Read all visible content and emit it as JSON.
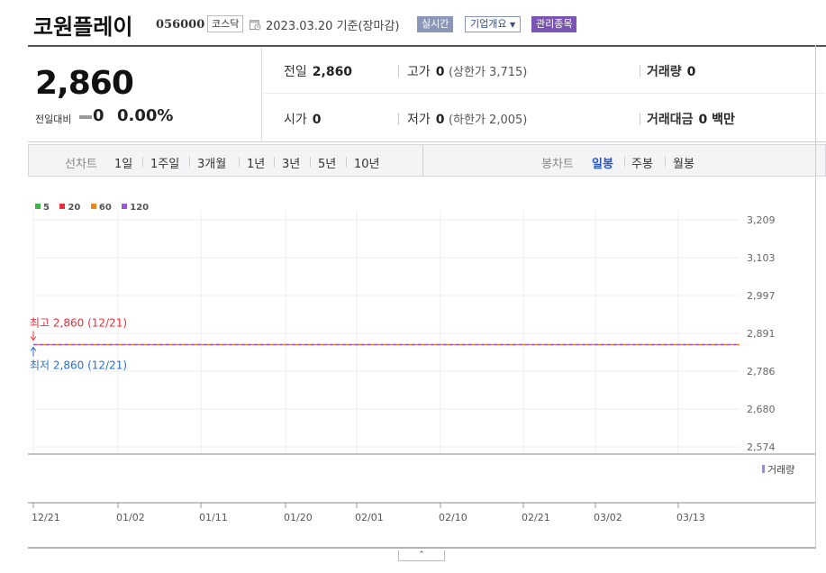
{
  "header": {
    "company_name": "코원플레이",
    "code": "056000",
    "market": "코스닥",
    "base_date": "2023.03.20 기준(장마감)",
    "btn_realtime": "실시간",
    "btn_overview": "기업개요",
    "btn_managed": "관리종목"
  },
  "price": {
    "current": "2,860",
    "change_label": "전일대비",
    "change_value": "0",
    "change_rate": "0.00%"
  },
  "info": {
    "prev_label": "전일",
    "prev_value": "2,860",
    "high_label": "고가",
    "high_value": "0",
    "upper_limit": "(상한가 3,715)",
    "volume_label": "거래량",
    "volume_value": "0",
    "open_label": "시가",
    "open_value": "0",
    "low_label": "저가",
    "low_value": "0",
    "lower_limit": "(하한가 2,005)",
    "amount_label": "거래대금",
    "amount_value": "0 백만"
  },
  "tabs": {
    "line_label": "선차트",
    "line_items": [
      "1일",
      "1주일",
      "3개월",
      "1년",
      "3년",
      "5년",
      "10년"
    ],
    "candle_label": "봉차트",
    "candle_items": [
      "일봉",
      "주봉",
      "월봉"
    ],
    "active_candle": "일봉"
  },
  "legend": [
    {
      "name": "5",
      "color": "#3cb44b"
    },
    {
      "name": "20",
      "color": "#e6303c"
    },
    {
      "name": "60",
      "color": "#f0861e"
    },
    {
      "name": "120",
      "color": "#9b59d0"
    }
  ],
  "chart_data": {
    "type": "line",
    "y_ticks": [
      "3,209",
      "3,103",
      "2,997",
      "2,891",
      "2,786",
      "2,680",
      "2,574"
    ],
    "ylim": [
      2574,
      3209
    ],
    "x_ticks": [
      "12/21",
      "01/02",
      "01/11",
      "01/20",
      "02/01",
      "02/10",
      "02/21",
      "03/02",
      "03/13"
    ],
    "series": [
      {
        "name": "5",
        "color": "#3cb44b",
        "values": [
          2860,
          2860
        ]
      },
      {
        "name": "20",
        "color": "#e6303c",
        "values": [
          2860,
          2860
        ]
      },
      {
        "name": "60",
        "color": "#f0861e",
        "values": [
          2860,
          2860
        ]
      },
      {
        "name": "120",
        "color": "#9b59d0",
        "values": [
          2860,
          2860
        ]
      }
    ],
    "price_value": 2860,
    "high_annotation": "최고 2,860 (12/21)",
    "low_annotation": "최저 2,860 (12/21)",
    "volume_label": "거래량"
  },
  "colors": {
    "high": "#e6303c",
    "low": "#2a6fc6",
    "active_tab": "#2a56c6"
  },
  "handle_glyph": "⌃"
}
